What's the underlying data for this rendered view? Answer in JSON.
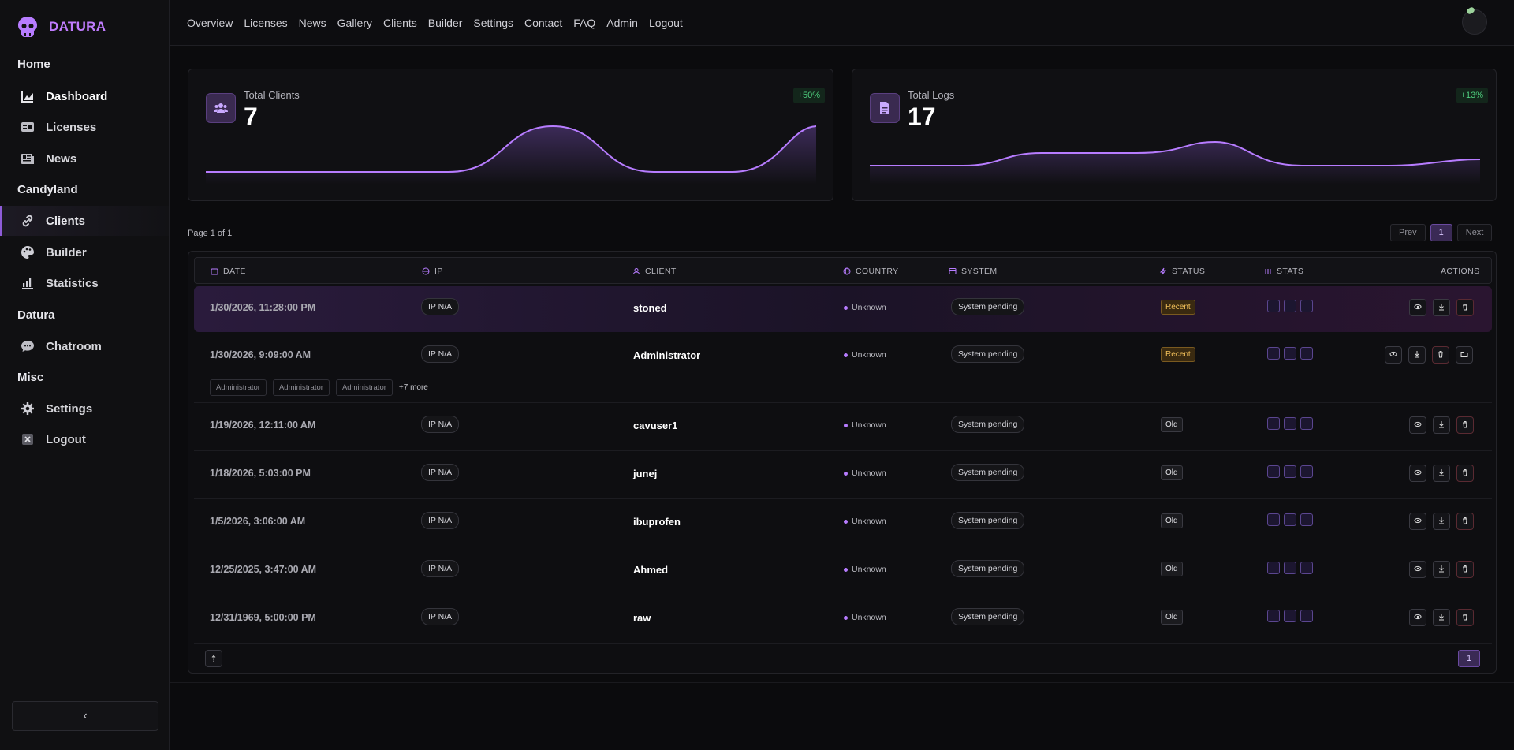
{
  "brand": {
    "name": "DATURA"
  },
  "sidebar": {
    "sections": [
      {
        "title": "Home",
        "items": [
          {
            "label": "Dashboard",
            "icon": "chart-area-icon"
          },
          {
            "label": "Licenses",
            "icon": "id-card-icon"
          },
          {
            "label": "News",
            "icon": "newspaper-icon"
          }
        ]
      },
      {
        "title": "Candyland",
        "items": [
          {
            "label": "Clients",
            "icon": "link-icon"
          },
          {
            "label": "Builder",
            "icon": "palette-icon"
          },
          {
            "label": "Statistics",
            "icon": "bar-chart-icon"
          }
        ]
      },
      {
        "title": "Datura",
        "items": [
          {
            "label": "Chatroom",
            "icon": "chat-icon"
          }
        ]
      },
      {
        "title": "Misc",
        "items": [
          {
            "label": "Settings",
            "icon": "gear-icon"
          },
          {
            "label": "Logout",
            "icon": "logout-icon"
          }
        ]
      }
    ],
    "collapse": "‹"
  },
  "topnav": [
    "Overview",
    "Licenses",
    "News",
    "Gallery",
    "Clients",
    "Builder",
    "Settings",
    "Contact",
    "FAQ",
    "Admin",
    "Logout"
  ],
  "cards": [
    {
      "label": "Total Clients",
      "value": "7",
      "badge": "+50%"
    },
    {
      "label": "Total Logs",
      "value": "17",
      "badge": "+13%"
    }
  ],
  "pagination": {
    "info": "Page 1 of 1",
    "prev": "Prev",
    "current": "1",
    "next": "Next"
  },
  "table": {
    "headers": {
      "date": "DATE",
      "ip": "IP",
      "client": "CLIENT",
      "country": "COUNTRY",
      "system": "SYSTEM",
      "status": "STATUS",
      "stats": "STATS",
      "actions": "ACTIONS"
    },
    "rows": [
      {
        "date": "1/30/2026, 11:28:00 PM",
        "ip": "IP N/A",
        "client": "stoned",
        "country": "Unknown",
        "system": "System pending",
        "status": "Recent"
      },
      {
        "date": "1/30/2026, 9:09:00 AM",
        "ip": "IP N/A",
        "client": "Administrator",
        "country": "Unknown",
        "system": "System pending",
        "status": "Recent",
        "tags": [
          "Administrator",
          "Administrator",
          "Administrator"
        ],
        "more": "+7 more"
      },
      {
        "date": "1/19/2026, 12:11:00 AM",
        "ip": "IP N/A",
        "client": "cavuser1",
        "country": "Unknown",
        "system": "System pending",
        "status": "Old"
      },
      {
        "date": "1/18/2026, 5:03:00 PM",
        "ip": "IP N/A",
        "client": "junej",
        "country": "Unknown",
        "system": "System pending",
        "status": "Old"
      },
      {
        "date": "1/5/2026, 3:06:00 AM",
        "ip": "IP N/A",
        "client": "ibuprofen",
        "country": "Unknown",
        "system": "System pending",
        "status": "Old"
      },
      {
        "date": "12/25/2025, 3:47:00 AM",
        "ip": "IP N/A",
        "client": "Ahmed",
        "country": "Unknown",
        "system": "System pending",
        "status": "Old"
      },
      {
        "date": "12/31/1969, 5:00:00 PM",
        "ip": "IP N/A",
        "client": "raw",
        "country": "Unknown",
        "system": "System pending",
        "status": "Old"
      }
    ],
    "footer_page": "1",
    "up_icon": "⇡"
  },
  "colors": {
    "accent": "#b77cff",
    "recent": "#f3c05a",
    "positive": "#4fd07f"
  }
}
